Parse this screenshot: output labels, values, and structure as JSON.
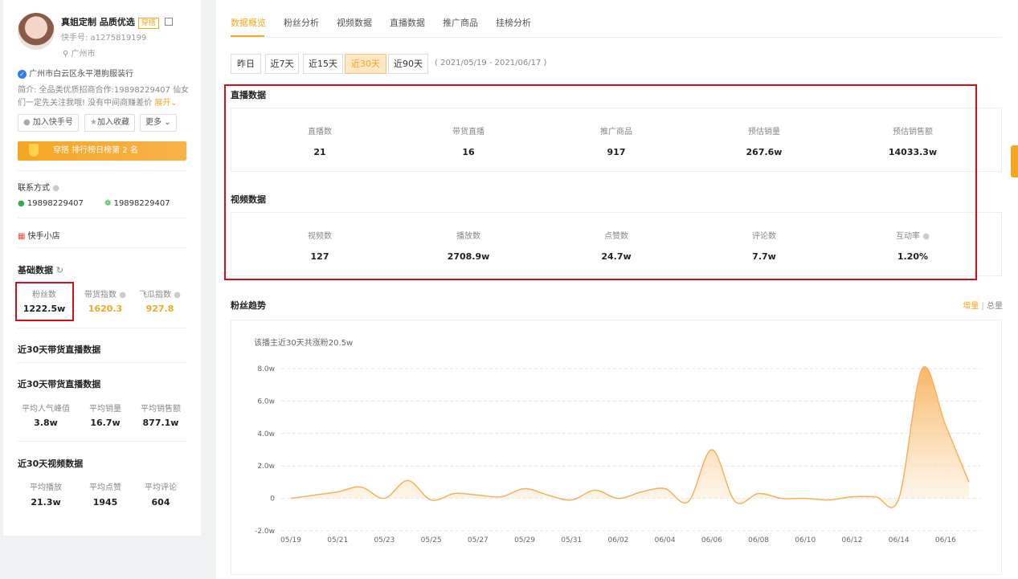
{
  "profile": {
    "nickname": "真姐定制 品质优选",
    "badge": "穿搭",
    "account_id": "快手号: a1275819199",
    "location": "广州市",
    "verified": "广州市白云区永平港朐服装行",
    "intro_line1": "简介: 全品类优质招商合作:19898229407 仙女",
    "intro_line2": "们一定先关注我哦! 没有中间商赚差价",
    "expand": "展开",
    "btn_follow": "加入快手号",
    "btn_collect": "加入收藏",
    "btn_more": "更多",
    "rank_text": "穿搭 排行榜日榜第 2 名"
  },
  "contact": {
    "title": "联系方式",
    "phone": "19898229407",
    "wechat": "19898229407",
    "shop": "快手小店"
  },
  "basic": {
    "title": "基础数据",
    "items": [
      {
        "label": "粉丝数",
        "value": "1222.5w"
      },
      {
        "label": "带货指数",
        "value": "1620.3"
      },
      {
        "label": "飞瓜指数",
        "value": "927.8"
      }
    ]
  },
  "live30_title": "近30天带货直播数据",
  "live30b": {
    "title": "近30天带货直播数据",
    "items": [
      {
        "label": "平均人气峰值",
        "value": "3.8w"
      },
      {
        "label": "平均销量",
        "value": "16.7w"
      },
      {
        "label": "平均销售额",
        "value": "877.1w"
      }
    ]
  },
  "video30": {
    "title": "近30天视频数据",
    "items": [
      {
        "label": "平均播放",
        "value": "21.3w"
      },
      {
        "label": "平均点赞",
        "value": "1945"
      },
      {
        "label": "平均评论",
        "value": "604"
      }
    ]
  },
  "tabs": [
    "数据概览",
    "粉丝分析",
    "视频数据",
    "直播数据",
    "推广商品",
    "挂榜分析"
  ],
  "date_filters": [
    "昨日",
    "近7天",
    "近15天",
    "近30天",
    "近90天"
  ],
  "date_range": "( 2021/05/19 - 2021/06/17 )",
  "live_section": {
    "title": "直播数据",
    "items": [
      {
        "label": "直播数",
        "value": "21"
      },
      {
        "label": "带货直播",
        "value": "16"
      },
      {
        "label": "推广商品",
        "value": "917"
      },
      {
        "label": "预估销量",
        "value": "267.6w"
      },
      {
        "label": "预估销售额",
        "value": "14033.3w"
      }
    ]
  },
  "video_section": {
    "title": "视频数据",
    "items": [
      {
        "label": "视频数",
        "value": "127"
      },
      {
        "label": "播放数",
        "value": "2708.9w"
      },
      {
        "label": "点赞数",
        "value": "24.7w"
      },
      {
        "label": "评论数",
        "value": "7.7w"
      },
      {
        "label": "互动率",
        "value": "1.20%"
      }
    ]
  },
  "fans_trend": {
    "title": "粉丝趋势",
    "toggle_inc": "增量",
    "toggle_sep": "|",
    "toggle_total": "总量",
    "summary": "该播主近30天共涨粉20.5w"
  },
  "chart_data": {
    "type": "area",
    "title": "",
    "y_ticks": [
      "8.0w",
      "6.0w",
      "4.0w",
      "2.0w",
      "0",
      "-2.0w"
    ],
    "ylim": [
      -2.0,
      8.0
    ],
    "x_tick_labels": [
      "05/19",
      "05/21",
      "05/23",
      "05/25",
      "05/27",
      "05/29",
      "05/31",
      "06/02",
      "06/04",
      "06/06",
      "06/08",
      "06/10",
      "06/12",
      "06/14",
      "06/16"
    ],
    "x": [
      "05/19",
      "05/20",
      "05/21",
      "05/22",
      "05/23",
      "05/24",
      "05/25",
      "05/26",
      "05/27",
      "05/28",
      "05/29",
      "05/30",
      "05/31",
      "06/01",
      "06/02",
      "06/03",
      "06/04",
      "06/05",
      "06/06",
      "06/07",
      "06/08",
      "06/09",
      "06/10",
      "06/11",
      "06/12",
      "06/13",
      "06/14",
      "06/15",
      "06/16",
      "06/17"
    ],
    "series": [
      {
        "values": [
          0.0,
          0.2,
          0.4,
          0.7,
          0.0,
          1.1,
          -0.1,
          0.3,
          0.2,
          0.1,
          0.6,
          0.2,
          -0.1,
          0.5,
          0.0,
          0.4,
          0.6,
          -0.2,
          3.0,
          -0.2,
          0.3,
          0.0,
          0.0,
          -0.1,
          0.1,
          0.1,
          0.0,
          8.0,
          4.5,
          1.0
        ],
        "color": "#f5a623"
      }
    ],
    "grid": true,
    "colors": {
      "line": "#f7b05b",
      "fill_top": "#f7a94a",
      "fill_bottom": "#fff3e3"
    }
  },
  "colors": {
    "accent": "#f5a623",
    "highlight_box": "#d3101a"
  }
}
